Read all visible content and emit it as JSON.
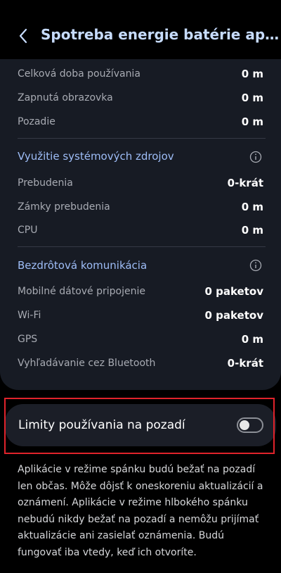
{
  "header": {
    "title": "Spotreba energie batérie aplikácie"
  },
  "usage": [
    {
      "label": "Celková doba používania",
      "value": "0 m"
    },
    {
      "label": "Zapnutá obrazovka",
      "value": "0 m"
    },
    {
      "label": "Pozadie",
      "value": "0 m"
    }
  ],
  "system": {
    "title": "Využitie systémových zdrojov",
    "rows": [
      {
        "label": "Prebudenia",
        "value": "0-krát"
      },
      {
        "label": "Zámky prebudenia",
        "value": "0 m"
      },
      {
        "label": "CPU",
        "value": "0 m"
      }
    ]
  },
  "wireless": {
    "title": "Bezdrôtová komunikácia",
    "rows": [
      {
        "label": "Mobilné dátové pripojenie",
        "value": "0 paketov"
      },
      {
        "label": "Wi-Fi",
        "value": "0 paketov"
      },
      {
        "label": "GPS",
        "value": "0 m"
      },
      {
        "label": "Vyhľadávanie cez Bluetooth",
        "value": "0-krát"
      }
    ]
  },
  "background_limits": {
    "label": "Limity používania na pozadí",
    "enabled": false
  },
  "description": "Aplikácie v režime spánku budú bežať na pozadí len občas. Môže dôjsť k oneskoreniu aktualizácií a oznámení. Aplikácie v režime hlbokého spánku nebudú nikdy bežať na pozadí a nemôžu prijímať aktualizácie ani zasielať oznámenia. Budú fungovať iba vtedy, keď ich otvoríte.",
  "colors": {
    "accent": "#9ebdf7",
    "highlight": "#e0232b"
  }
}
